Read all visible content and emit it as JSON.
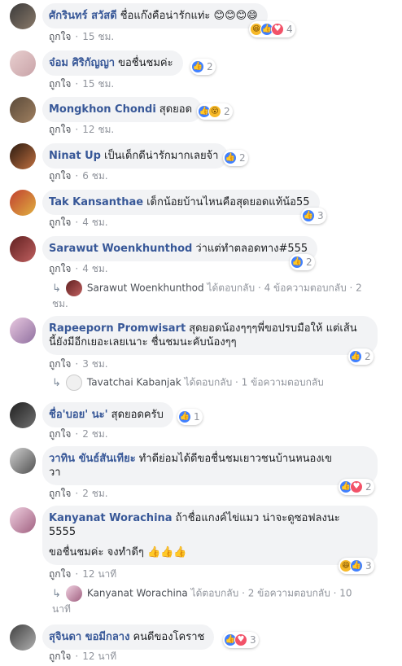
{
  "ui": {
    "like": "ถูกใจ",
    "dot": "·",
    "replied": "ได้ตอบกลับ"
  },
  "comments": [
    {
      "author": "ศักรินทร์ สวัสดี",
      "text": "ชื่อแก๊งคือน่ารักแท่ะ 😊😊😊😄",
      "time": "15 ชม.",
      "reactions": [
        "haha",
        "like",
        "heart"
      ],
      "count": "4"
    },
    {
      "author": "จ๋อม ศิริกัญญา",
      "text": "ขอชื่นชมค่ะ",
      "time": "15 ชม.",
      "reactions": [
        "like"
      ],
      "count": "2"
    },
    {
      "author": "Mongkhon Chondi",
      "text": "สุดยอด",
      "time": "12 ชม.",
      "reactions": [
        "like",
        "wow"
      ],
      "count": "2"
    },
    {
      "author": "Ninat Up",
      "text": "เป็นเด็กดีน่ารักมากเลยจ้า",
      "time": "6 ชม.",
      "reactions": [
        "like"
      ],
      "count": "2"
    },
    {
      "author": "Tak Kansanthae",
      "text": "เด็กน้อยบ้านไหนคือสุดยอดแท้น้อ55",
      "time": "4 ชม.",
      "reactions": [
        "like"
      ],
      "count": "3"
    },
    {
      "author": "Sarawut Woenkhunthod",
      "text": "ว่าแต่ทำตลอดทาง#555",
      "time": "4 ชม.",
      "reactions": [
        "like"
      ],
      "count": "2",
      "reply": {
        "name": "Sarawut Woenkhunthod",
        "meta": "4 ข้อความตอบกลับ · 2",
        "meta2": "ชม."
      }
    },
    {
      "author": "Rapeeporn Promwisart",
      "text": "สุดยอดน้องๆๆๆพี่ขอปรบมือให้ แต่เส้น",
      "text2": "นี้ยังมีอีกเยอะเลยเนาะ ชื่นชมนะคับน้องๆๆ",
      "time": "3 ชม.",
      "reactions": [
        "like"
      ],
      "count": "2",
      "reply": {
        "name": "Tavatchai Kabanjak",
        "meta": "1 ข้อความตอบกลับ"
      }
    },
    {
      "author": "ชื่อ'บอย' นะ'",
      "text": "สุดยอดครับ",
      "time": "2 ชม.",
      "reactions": [
        "like"
      ],
      "count": "1"
    },
    {
      "author": "วาทิน ขันธ์สันเทียะ",
      "text": "ทำดีย่อมได้ดีขอชื่นชมเยาวชนบ้านหนองเข",
      "text2": "วา",
      "time": "2 ชม.",
      "reactions": [
        "like",
        "heart"
      ],
      "count": "2"
    },
    {
      "author": "Kanyanat Worachina",
      "text": "ถ้าชื่อแกงค์ไข่แมว น่าจะดูซอฟลงนะ",
      "text2": "5555",
      "text3": "ขอชื่นชมค่ะ จงทำดีๆ 👍👍👍",
      "time": "12 นาที",
      "reactions": [
        "haha",
        "like"
      ],
      "count": "3",
      "reply": {
        "name": "Kanyanat Worachina",
        "meta": "2 ข้อความตอบกลับ · 10",
        "meta2": "นาที"
      }
    },
    {
      "author": "สุจินดา ขอมีกลาง",
      "text": "คนดีของโคราช",
      "time": "12 นาที",
      "reactions": [
        "like",
        "heart"
      ],
      "count": "3"
    }
  ],
  "colors": {
    "link": "#385898",
    "bubble": "#f2f3f5",
    "meta": "#90949c",
    "like_blue": "#4080ff",
    "heart_red": "#f25268"
  },
  "icons": {
    "reply": "reply-arrow-icon",
    "like": "like-reaction-icon",
    "heart": "love-reaction-icon",
    "haha": "haha-reaction-icon",
    "wow": "wow-reaction-icon"
  }
}
